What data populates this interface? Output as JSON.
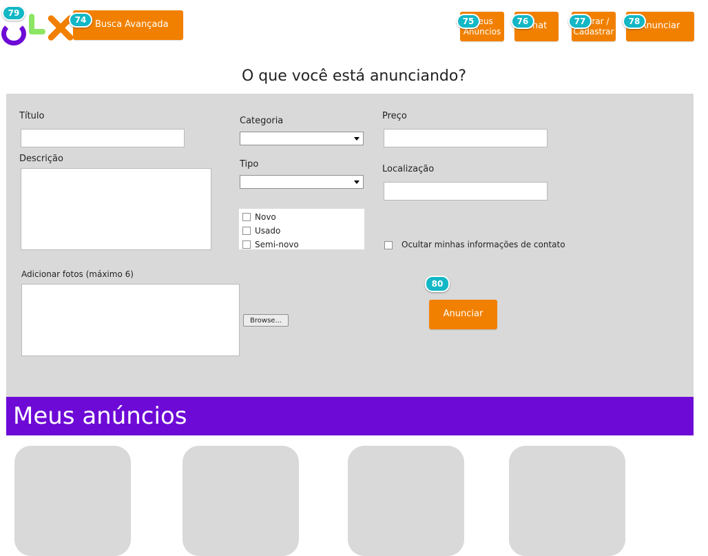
{
  "header": {
    "logo_badge": "79",
    "busca": {
      "label": "Busca Avançada",
      "badge": "74"
    },
    "meus_anuncios": {
      "label": "Meus Anúncios",
      "badge": "75"
    },
    "chat": {
      "label": "Chat",
      "badge": "76"
    },
    "entrar": {
      "label": "Entrar / Cadastrar",
      "badge": "77"
    },
    "anunciar": {
      "label": "Anunciar",
      "badge": "78"
    }
  },
  "page_title": "O que você está anunciando?",
  "form": {
    "titulo_label": "Título",
    "titulo_value": "",
    "descricao_label": "Descrição",
    "descricao_value": "",
    "categoria_label": "Categoria",
    "categoria_value": "",
    "tipo_label": "Tipo",
    "tipo_value": "",
    "condicao_options": [
      "Novo",
      "Usado",
      "Semi-novo"
    ],
    "preco_label": "Preço",
    "preco_value": "",
    "localizacao_label": "Localização",
    "localizacao_value": "",
    "ocultar_label": "Ocultar minhas informações de contato",
    "fotos_label": "Adicionar fotos (máximo 6)",
    "browse_label": "Browse...",
    "submit": {
      "label": "Anunciar",
      "badge": "80"
    }
  },
  "meus_anuncios_heading": "Meus anúncios",
  "colors": {
    "orange": "#f28000",
    "purple": "#6e0ad6",
    "green": "#8ce563",
    "badge": "#13b7c5",
    "panel": "#d9d9d9"
  }
}
